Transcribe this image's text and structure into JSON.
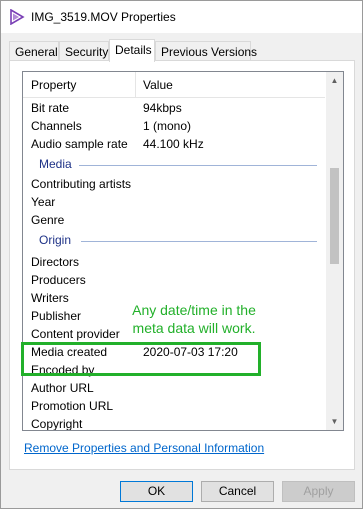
{
  "window": {
    "title": "IMG_3519.MOV Properties"
  },
  "tabs": [
    {
      "label": "General"
    },
    {
      "label": "Security"
    },
    {
      "label": "Details"
    },
    {
      "label": "Previous Versions"
    }
  ],
  "details": {
    "col_property": "Property",
    "col_value": "Value",
    "rows_audio": [
      {
        "property": "Bit rate",
        "value": "94kbps"
      },
      {
        "property": "Channels",
        "value": "1 (mono)"
      },
      {
        "property": "Audio sample rate",
        "value": "44.100 kHz"
      }
    ],
    "group_media": "Media",
    "rows_media": [
      {
        "property": "Contributing artists",
        "value": ""
      },
      {
        "property": "Year",
        "value": ""
      },
      {
        "property": "Genre",
        "value": ""
      }
    ],
    "group_origin": "Origin",
    "rows_origin": [
      {
        "property": "Directors",
        "value": ""
      },
      {
        "property": "Producers",
        "value": ""
      },
      {
        "property": "Writers",
        "value": ""
      },
      {
        "property": "Publisher",
        "value": ""
      },
      {
        "property": "Content provider",
        "value": ""
      },
      {
        "property": "Media created",
        "value": "2020-07-03 17:20"
      },
      {
        "property": "Encoded by",
        "value": ""
      },
      {
        "property": "Author URL",
        "value": ""
      },
      {
        "property": "Promotion URL",
        "value": ""
      },
      {
        "property": "Copyright",
        "value": ""
      }
    ]
  },
  "link": {
    "label": "Remove Properties and Personal Information"
  },
  "buttons": {
    "ok": "OK",
    "cancel": "Cancel",
    "apply": "Apply"
  },
  "annotation": {
    "text": "Any date/time in the meta data will work.",
    "color": "#22b02a"
  }
}
